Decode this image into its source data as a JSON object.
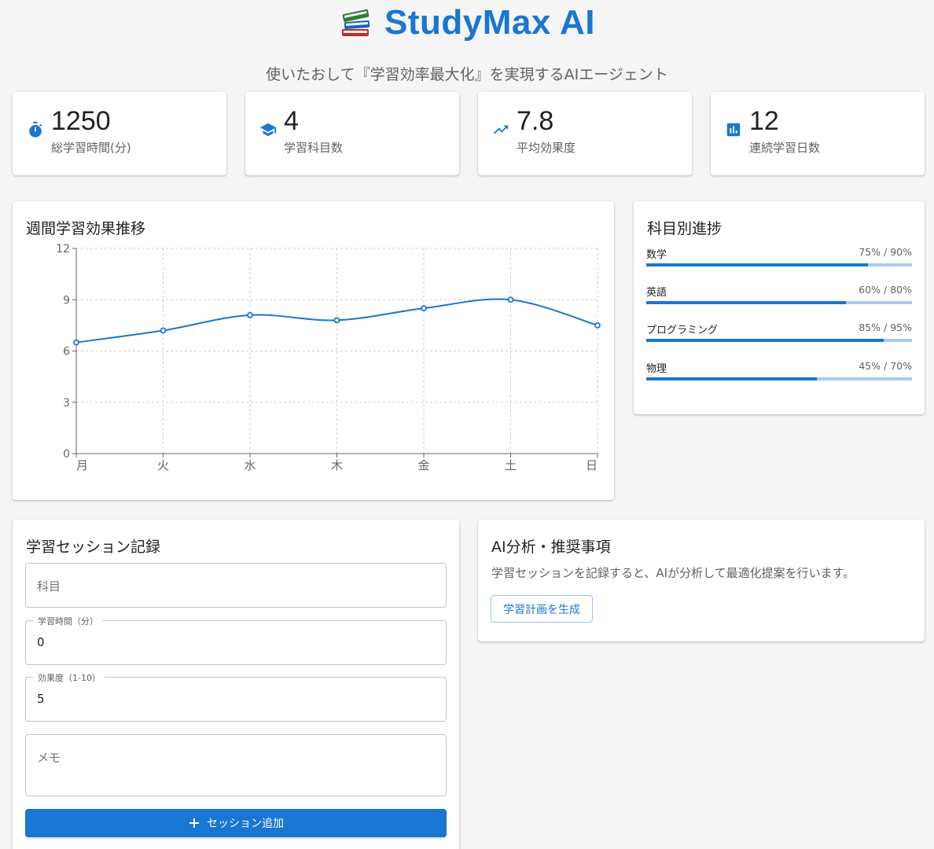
{
  "header": {
    "title": "StudyMax AI",
    "icon": "books-icon",
    "subtitle": "使いたおして『学習効率最大化』を実現するAIエージェント"
  },
  "stats": [
    {
      "icon": "stopwatch-icon",
      "value": "1250",
      "label": "総学習時間(分)"
    },
    {
      "icon": "school-icon",
      "value": "4",
      "label": "学習科目数"
    },
    {
      "icon": "trending-up-icon",
      "value": "7.8",
      "label": "平均効果度"
    },
    {
      "icon": "bar-chart-icon",
      "value": "12",
      "label": "連続学習日数"
    }
  ],
  "weekly_chart": {
    "title": "週間学習効果推移"
  },
  "chart_data": {
    "type": "line",
    "categories": [
      "月",
      "火",
      "水",
      "木",
      "金",
      "土",
      "日"
    ],
    "values": [
      6.5,
      7.2,
      8.1,
      7.8,
      8.5,
      9.0,
      7.5
    ],
    "ylim": [
      0,
      12
    ],
    "yticks": [
      "0",
      "3",
      "6",
      "9",
      "12"
    ],
    "grid": true,
    "color": "#1976d2"
  },
  "subject_progress": {
    "title": "科目別進捗",
    "items": [
      {
        "name": "数学",
        "value_text": "75% / 90%",
        "progress": 75,
        "target": 90
      },
      {
        "name": "英語",
        "value_text": "60% / 80%",
        "progress": 60,
        "target": 80
      },
      {
        "name": "プログラミング",
        "value_text": "85% / 95%",
        "progress": 85,
        "target": 95
      },
      {
        "name": "物理",
        "value_text": "45% / 70%",
        "progress": 45,
        "target": 70
      }
    ]
  },
  "session_form": {
    "title": "学習セッション記録",
    "subject_placeholder": "科目",
    "time_label": "学習時間（分）",
    "time_value": "0",
    "effect_label": "効果度（1-10）",
    "effect_value": "5",
    "memo_placeholder": "メモ",
    "add_button": "セッション追加"
  },
  "ai_panel": {
    "title": "AI分析・推奨事項",
    "description": "学習セッションを記録すると、AIが分析して最適化提案を行います。",
    "plan_button": "学習計画を生成"
  },
  "colors": {
    "primary": "#1976d2",
    "primary_light": "#a8caef",
    "background": "#f5f5f5"
  }
}
